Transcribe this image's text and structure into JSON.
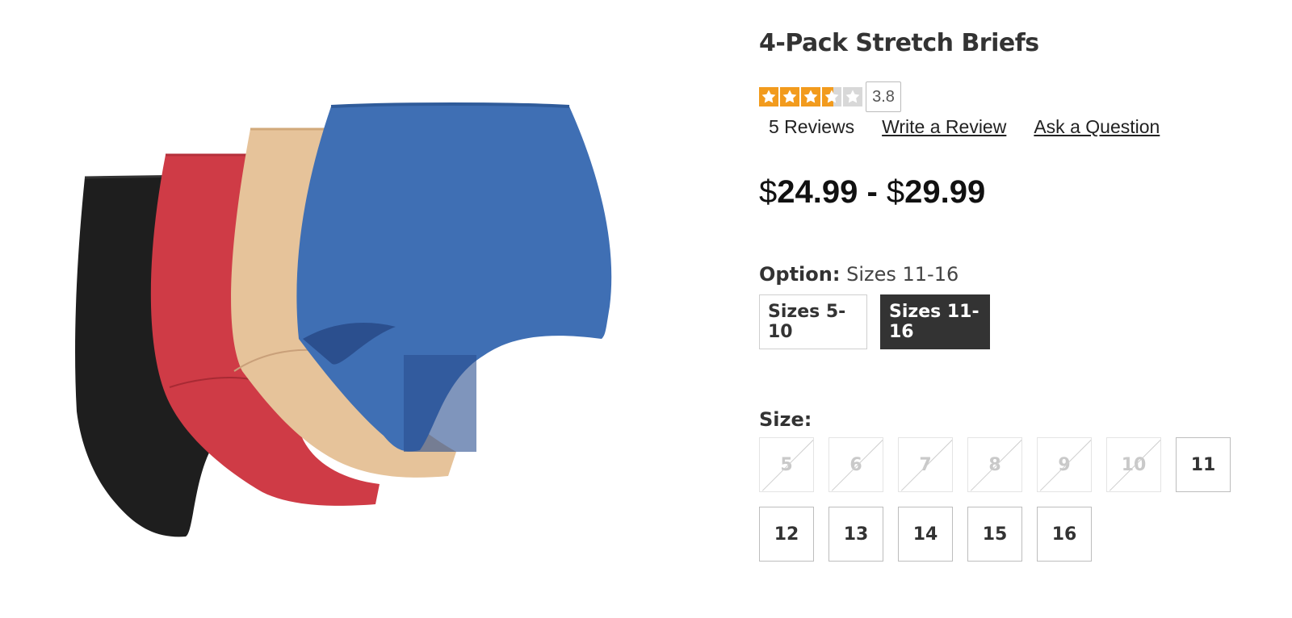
{
  "product": {
    "title": "4-Pack Stretch Briefs",
    "image_alt": "Four stretch briefs in black, red, beige and blue"
  },
  "rating": {
    "value": "3.8",
    "stars_filled": 3.5,
    "stars_total": 5,
    "star_color": "#f29b1d",
    "star_empty_color": "#d8d8d8"
  },
  "reviews": {
    "count_label": "5 Reviews",
    "write_label": "Write a Review",
    "ask_label": "Ask a Question"
  },
  "price": {
    "currency": "$",
    "low": "24.99",
    "separator": " - ",
    "high": "29.99"
  },
  "option": {
    "label": "Option:",
    "selected_value": "Sizes 11-16",
    "choices": [
      {
        "label": "Sizes 5-10",
        "selected": false
      },
      {
        "label": "Sizes 11-16",
        "selected": true
      }
    ]
  },
  "size": {
    "label": "Size:",
    "choices": [
      {
        "label": "5",
        "available": false
      },
      {
        "label": "6",
        "available": false
      },
      {
        "label": "7",
        "available": false
      },
      {
        "label": "8",
        "available": false
      },
      {
        "label": "9",
        "available": false
      },
      {
        "label": "10",
        "available": false
      },
      {
        "label": "11",
        "available": true
      },
      {
        "label": "12",
        "available": true
      },
      {
        "label": "13",
        "available": true
      },
      {
        "label": "14",
        "available": true
      },
      {
        "label": "15",
        "available": true
      },
      {
        "label": "16",
        "available": true
      }
    ]
  },
  "colors": {
    "brief_black": "#1e1e1e",
    "brief_red": "#cf3b46",
    "brief_beige": "#e6c39a",
    "brief_blue": "#3f6fb4",
    "selected_button_bg": "#333333"
  }
}
